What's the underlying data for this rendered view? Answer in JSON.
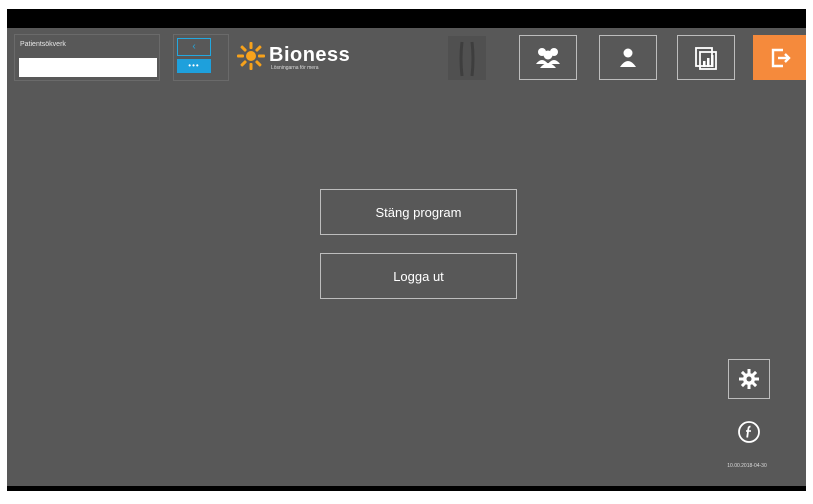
{
  "header": {
    "patient_label": "Patientsökverk",
    "patient_value": "",
    "device_top_glyph": "‹",
    "device_bottom_text": "•••",
    "logo_text": "Bioness",
    "logo_sub": "Lösningarna för mera"
  },
  "toolbar": {
    "icons": [
      "legs-icon",
      "patients-group-icon",
      "user-icon",
      "report-icon",
      "exit-icon"
    ]
  },
  "menu": {
    "close_program_label": "Stäng program",
    "logout_label": "Logga ut"
  },
  "footer": {
    "version_text": "10.00.2018-04-30"
  },
  "colors": {
    "background": "#585858",
    "accent_orange": "#f58a3c",
    "accent_blue": "#1ea0dc",
    "logo_orange": "#f7a21b"
  }
}
